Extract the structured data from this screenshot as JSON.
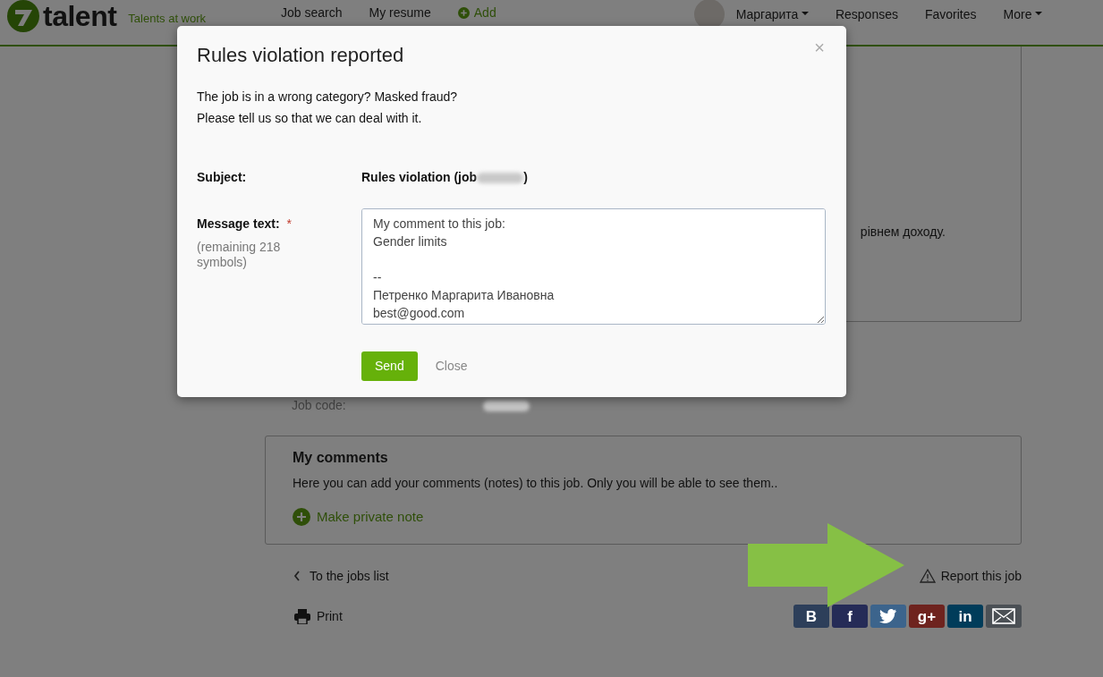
{
  "header": {
    "brand": "talent",
    "tagline": "Talents at work",
    "nav": [
      {
        "label": "Job search",
        "kind": "link"
      },
      {
        "label": "My resume",
        "kind": "link"
      },
      {
        "label": "Add",
        "kind": "add"
      }
    ],
    "user": {
      "name": "Маргарита"
    },
    "nav_right": [
      {
        "label": "Responses",
        "kind": "link"
      },
      {
        "label": "Favorites",
        "kind": "link"
      },
      {
        "label": "More",
        "kind": "dropdown"
      }
    ]
  },
  "job_card": {
    "text_fragment": "рівнем доходу."
  },
  "job_code": {
    "label": "Job code:"
  },
  "comments": {
    "title": "My comments",
    "description": "Here you can add your comments (notes) to this job. Only you will be able to see them..",
    "action": "Make private note"
  },
  "back_link": "To the jobs list",
  "report_link": "Report this job",
  "print_link": "Print",
  "share_buttons": [
    {
      "kind": "letter",
      "label": "B",
      "color": "#2d3f5a"
    },
    {
      "kind": "letter",
      "label": "f",
      "color": "#252b57"
    },
    {
      "kind": "bird",
      "color": "#3c648c"
    },
    {
      "kind": "letter",
      "label": "g+",
      "color": "#6e231e"
    },
    {
      "kind": "letter",
      "label": "in",
      "color": "#003c5a"
    },
    {
      "kind": "mail",
      "color": "#4b5055"
    }
  ],
  "modal": {
    "title": "Rules violation reported",
    "close": "×",
    "intro": [
      "The job is in a wrong category? Masked fraud?",
      "Please tell us so that we can deal with it."
    ],
    "subject_label": "Subject:",
    "subject_value": "Rules violation (job",
    "subject_suffix": ")",
    "message_label": "Message text:",
    "required_mark": "*",
    "remaining": "(remaining 218 symbols)",
    "message": "My comment to this job:\nGender limits\n\n--\nПетренко Маргарита Ивановна\nbest@good.com",
    "buttons": [
      {
        "label": "Send",
        "kind": "primary"
      },
      {
        "label": "Close",
        "kind": "link"
      }
    ]
  }
}
